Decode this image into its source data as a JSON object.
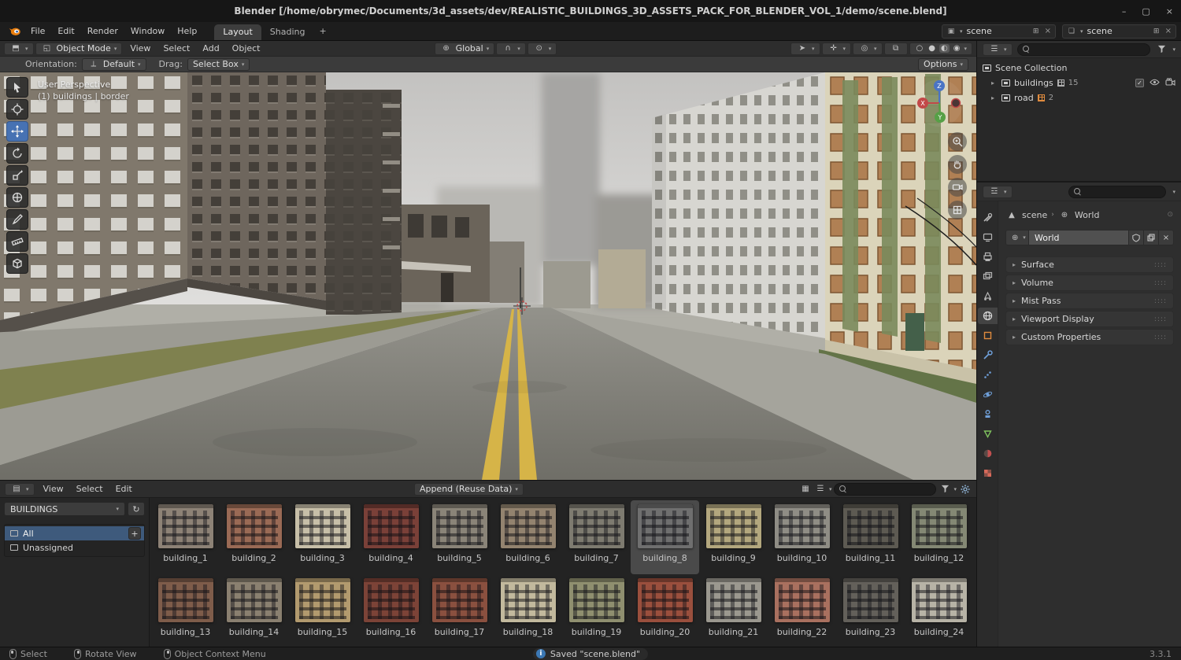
{
  "window": {
    "title": "Blender [/home/obrymec/Documents/3d_assets/dev/REALISTIC_BUILDINGS_3D_ASSETS_PACK_FOR_BLENDER_VOL_1/demo/scene.blend]",
    "controls": {
      "minimize": "–",
      "maximize": "▢",
      "close": "×"
    }
  },
  "topbar": {
    "menus": [
      "File",
      "Edit",
      "Render",
      "Window",
      "Help"
    ],
    "workspaces": [
      {
        "label": "Layout",
        "active": true
      },
      {
        "label": "Shading",
        "active": false
      }
    ],
    "new_workspace": "+",
    "scene_selector": "scene",
    "view_layer_selector": "scene"
  },
  "viewport": {
    "mode": "Object Mode",
    "menus": [
      "View",
      "Select",
      "Add",
      "Object"
    ],
    "orientation": "Global",
    "tool_settings": {
      "orientation_label": "Orientation:",
      "orientation_value": "Default",
      "drag_label": "Drag:",
      "drag_value": "Select Box",
      "options": "Options"
    },
    "overlay": {
      "line1": "User Perspective",
      "line2": "(1) buildings | border"
    },
    "gizmo": {
      "x": "X",
      "y": "Y",
      "z": "Z"
    }
  },
  "outliner": {
    "scene_collection": "Scene Collection",
    "items": [
      {
        "label": "buildings",
        "count": "15"
      },
      {
        "label": "road",
        "count": "2"
      }
    ]
  },
  "properties": {
    "breadcrumb": {
      "scene": "scene",
      "world": "World"
    },
    "world_name": "World",
    "sections": [
      "Surface",
      "Volume",
      "Mist Pass",
      "Viewport Display",
      "Custom Properties"
    ]
  },
  "asset_browser": {
    "menus": [
      "View",
      "Select",
      "Edit"
    ],
    "import_method": "Append (Reuse Data)",
    "library": "BUILDINGS",
    "catalogs": [
      {
        "label": "All",
        "selected": true
      },
      {
        "label": "Unassigned",
        "selected": false
      }
    ],
    "assets": [
      {
        "label": "building_1",
        "color": "#8d8276"
      },
      {
        "label": "building_2",
        "color": "#9a6a55"
      },
      {
        "label": "building_3",
        "color": "#c7bfa8"
      },
      {
        "label": "building_4",
        "color": "#7a4038"
      },
      {
        "label": "building_5",
        "color": "#8a8478"
      },
      {
        "label": "building_6",
        "color": "#93836f"
      },
      {
        "label": "building_7",
        "color": "#7e7b70"
      },
      {
        "label": "building_8",
        "color": "#6f6f6f",
        "selected": true
      },
      {
        "label": "building_9",
        "color": "#b3a77e"
      },
      {
        "label": "building_10",
        "color": "#8f8d85"
      },
      {
        "label": "building_11",
        "color": "#5d5a52"
      },
      {
        "label": "building_12",
        "color": "#848874"
      },
      {
        "label": "building_13",
        "color": "#7e5c4a"
      },
      {
        "label": "building_14",
        "color": "#8a8070"
      },
      {
        "label": "building_15",
        "color": "#b29a6e"
      },
      {
        "label": "building_16",
        "color": "#7c4337"
      },
      {
        "label": "building_17",
        "color": "#8a503f"
      },
      {
        "label": "building_18",
        "color": "#c2b99d"
      },
      {
        "label": "building_19",
        "color": "#8f8f6f"
      },
      {
        "label": "building_20",
        "color": "#9a4f3d"
      },
      {
        "label": "building_21",
        "color": "#9b988f"
      },
      {
        "label": "building_22",
        "color": "#a9705f"
      },
      {
        "label": "building_23",
        "color": "#63605a"
      },
      {
        "label": "building_24",
        "color": "#b7b3a6"
      }
    ]
  },
  "status_bar": {
    "hints": [
      "Select",
      "Rotate View",
      "Object Context Menu"
    ],
    "message": "Saved \"scene.blend\"",
    "version": "3.3.1"
  }
}
